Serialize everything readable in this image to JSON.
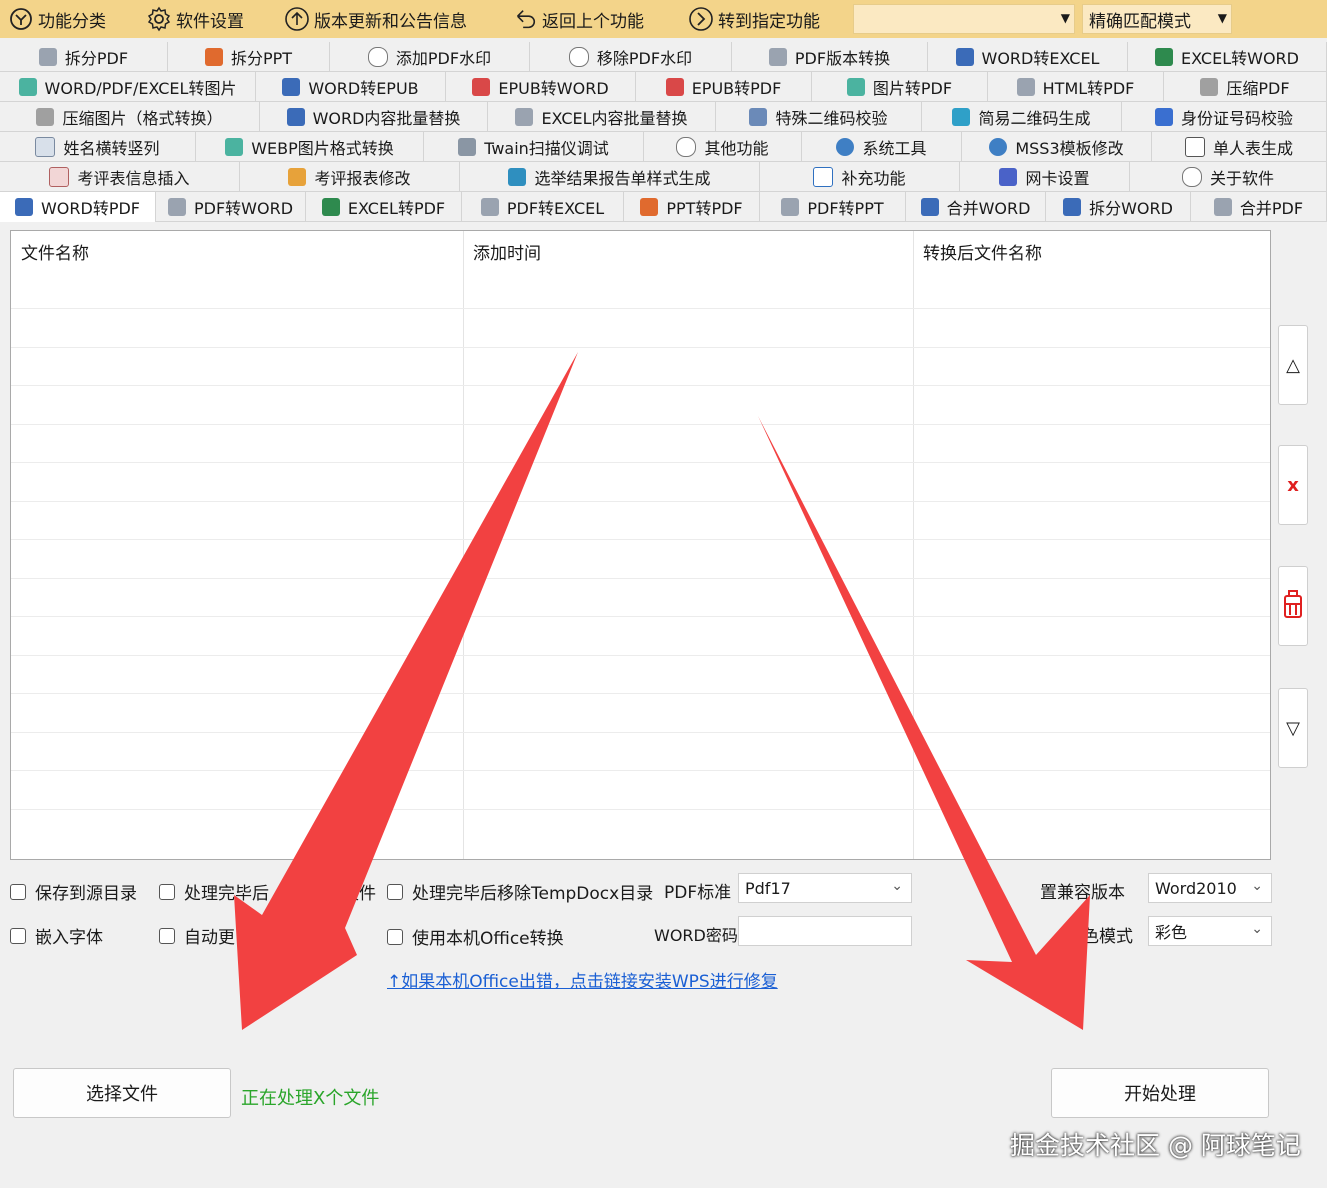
{
  "toolbar": {
    "items": [
      {
        "label": "功能分类",
        "icon": "category-icon"
      },
      {
        "label": "软件设置",
        "icon": "gear-icon"
      },
      {
        "label": "版本更新和公告信息",
        "icon": "update-arrow-icon"
      },
      {
        "label": "返回上个功能",
        "icon": "back-icon"
      },
      {
        "label": "转到指定功能",
        "icon": "goto-icon"
      }
    ],
    "search_combo_value": "",
    "match_mode": "精确匹配模式"
  },
  "tabs": {
    "row1": [
      "拆分PDF",
      "拆分PPT",
      "添加PDF水印",
      "移除PDF水印",
      "PDF版本转换",
      "WORD转EXCEL",
      "EXCEL转WORD"
    ],
    "row2": [
      "WORD/PDF/EXCEL转图片",
      "WORD转EPUB",
      "EPUB转WORD",
      "EPUB转PDF",
      "图片转PDF",
      "HTML转PDF",
      "压缩PDF"
    ],
    "row3": [
      "压缩图片（格式转换）",
      "WORD内容批量替换",
      "EXCEL内容批量替换",
      "特殊二维码校验",
      "简易二维码生成",
      "身份证号码校验"
    ],
    "row4": [
      "姓名横转竖列",
      "WEBP图片格式转换",
      "Twain扫描仪调试",
      "其他功能",
      "系统工具",
      "MSS3模板修改",
      "单人表生成"
    ],
    "row5": [
      "考评表信息插入",
      "考评报表修改",
      "选举结果报告单样式生成",
      "补充功能",
      "网卡设置",
      "关于软件"
    ],
    "row6": [
      "WORD转PDF",
      "PDF转WORD",
      "EXCEL转PDF",
      "PDF转EXCEL",
      "PPT转PDF",
      "PDF转PPT",
      "合并WORD",
      "拆分WORD",
      "合并PDF"
    ],
    "active": "WORD转PDF"
  },
  "file_list": {
    "columns": [
      "文件名称",
      "添加时间",
      "转换后文件名称"
    ],
    "rows": []
  },
  "side_buttons": {
    "up": "△",
    "delete": "x",
    "clear_icon": "trash-icon",
    "down": "▽"
  },
  "options": {
    "save_to_source": "保存到源目录",
    "after_process_prefix": "处理完毕后",
    "after_process_suffix": "文件",
    "remove_temp": "处理完毕后移除TempDocx目录",
    "embed_fonts": "嵌入字体",
    "auto_update_prefix": "自动更",
    "use_office": "使用本机Office转换",
    "pdf_standard_label": "PDF标准",
    "pdf_standard_value": "Pdf17",
    "word_password_label": "WORD密码",
    "word_password_value": "",
    "compat_label": "置兼容版本",
    "compat_value": "Word2010",
    "color_label": "色模式",
    "color_value": "彩色",
    "link": "↑如果本机Office出错，点击链接安装WPS进行修复"
  },
  "actions": {
    "select_file": "选择文件",
    "status": "正在处理X个文件",
    "start": "开始处理"
  },
  "watermark": "掘金技术社区 @ 阿球笔记",
  "colors": {
    "toolbar_bg": "#f3d48a",
    "arrow_red": "#f24141",
    "status_green": "#2aa52a",
    "link_blue": "#1a5fd4"
  }
}
